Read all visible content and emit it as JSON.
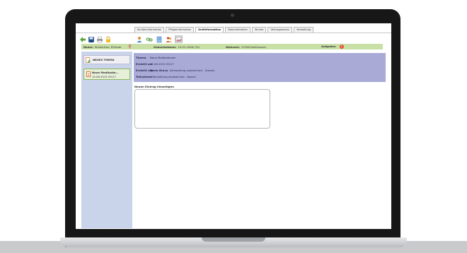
{
  "tabs": [
    {
      "label": "Kundeninformation",
      "active": false
    },
    {
      "label": "Pflegeinformation",
      "active": false
    },
    {
      "label": "Arztinformation",
      "active": true
    },
    {
      "label": "Dokumentation",
      "active": false
    },
    {
      "label": "Wunde",
      "active": false
    },
    {
      "label": "Vertragswesen",
      "active": false
    },
    {
      "label": "Verwaltung",
      "active": false
    }
  ],
  "toolbar": {
    "left_icons": [
      "back-arrow-icon",
      "save-icon",
      "print-icon",
      "lock-icon"
    ],
    "right_icons": [
      "user-icon",
      "link-icon",
      "document-icon",
      "people-icon",
      "image-icon"
    ]
  },
  "patient": {
    "name_label": "Name:",
    "name_value": "Musterfrau, Elfriede",
    "birth_label": "Geburtsdatum:",
    "birth_value": "15.01.1946 (70)",
    "residence_label": "Wohnort:",
    "residence_value": "12346 Kohlhausen",
    "tasks_label": "Aufgaben",
    "tasks_count": "3"
  },
  "sidebar": {
    "new_topic_label": "NEUES THEMA",
    "entry_title": "Neue Medikatio...",
    "entry_date": "15.06.2015 09:27"
  },
  "detail": {
    "thema_label": "Thema",
    "thema_value": "Neue Medikationen",
    "created_label": "Erstellt am",
    "created_value": "15.06.2015 09:27",
    "author_label": "Erstellt von",
    "author_name": "Berta Bravo",
    "author_org": "(Verwaltung asolearCare - Kassel)",
    "participants_label": "Teilnehmer",
    "participants_value": "• Verwaltung asolearCare - Kassel"
  },
  "new_entry": {
    "label": "Neuen Eintrag hinzufügen",
    "value": ""
  },
  "colors": {
    "name_bar": "#c8dfa6",
    "sidebar": "#c9d3ea",
    "info_panel": "#a9aad6",
    "badge": "#e34b2b",
    "bezel": "#171717"
  }
}
